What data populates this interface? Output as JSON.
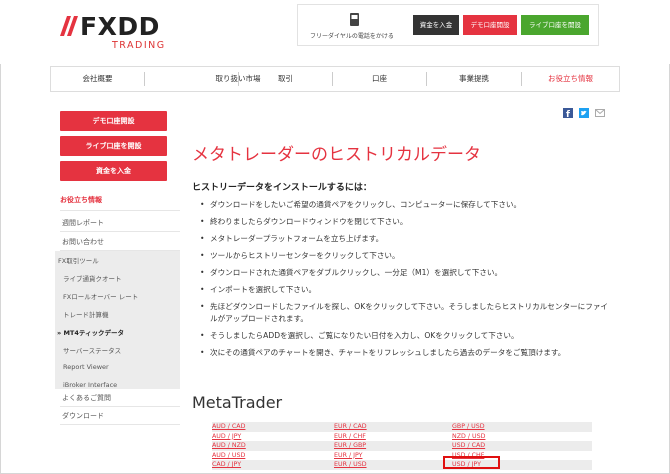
{
  "header": {
    "logo_name": "FXDD",
    "logo_sub": "TRADING",
    "phone_text": "フリーダイヤルの電話をかける",
    "btn_deposit": "資金を入金",
    "btn_demo": "デモ口座開設",
    "btn_live": "ライブ口座を開設"
  },
  "nav": [
    "会社概要",
    "取り扱い市場",
    "取引",
    "口座",
    "事業提携",
    "お役立ち情報"
  ],
  "sidebar": {
    "btn_demo": "デモ口座開設",
    "btn_live": "ライブ口座を開設",
    "btn_deposit": "資金を入金",
    "heading": "お役立ち情報",
    "items": [
      "週間レポート",
      "お問い合わせ",
      "FX取引ツール"
    ],
    "subitems": [
      "ライブ通貨クオート",
      "FXロールオーバー レート",
      "トレード計算機",
      "MT4ティックデータ",
      "サーバーステータス",
      "Report Viewer",
      "iBroker Interface"
    ],
    "bottom_items": [
      "よくあるご質問",
      "ダウンロード"
    ]
  },
  "main": {
    "title": "メタトレーダーのヒストリカルデータ",
    "subtitle": "ヒストリーデータをインストールするには：",
    "bullets": [
      "ダウンロードをしたいご希望の通貨ペアをクリックし、コンピューターに保存して下さい。",
      "終わりましたらダウンロードウィンドウを閉じて下さい。",
      "メタトレーダープラットフォームを立ち上げます。",
      "ツールからヒストリーセンターをクリックして下さい。",
      "ダウンロードされた通貨ペアをダブルクリックし、一分足（M1）を選択して下さい。",
      "インポートを選択して下さい。",
      "先ほどダウンロードしたファイルを探し、OKをクリックして下さい。そうしましたらヒストリカルセンターにファイルがアップロードされます。",
      "そうしましたらADDを選択し、ご覧になりたい日付を入力し、OKをクリックして下さい。",
      "次にその通貨ペアのチャートを開き、チャートをリフレッシュしましたら過去のデータをご覧頂けます。"
    ],
    "mt_title": "MetaTrader",
    "table": [
      [
        "AUD / CAD",
        "EUR / CAD",
        "GBP / USD"
      ],
      [
        "AUD / JPY",
        "EUR / CHF",
        "NZD / USD"
      ],
      [
        "AUD / NZD",
        "EUR / GBP",
        "USD / CAD"
      ],
      [
        "AUD / USD",
        "EUR / JPY",
        "USD / CHF"
      ],
      [
        "CAD / JPY",
        "EUR / USD",
        "USD / JPY"
      ]
    ]
  },
  "colors": {
    "accent": "#e53340",
    "live": "#4aa62e",
    "deposit": "#333333",
    "highlight": "#e01010"
  }
}
